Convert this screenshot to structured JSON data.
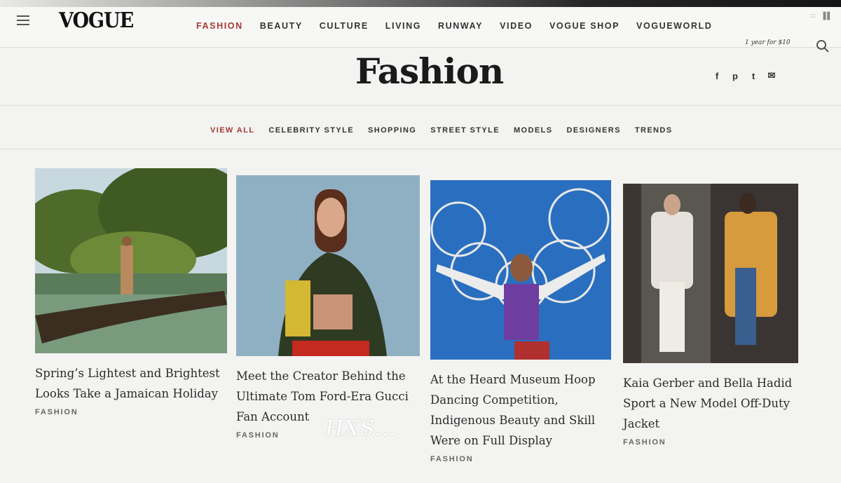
{
  "header": {
    "logo": "VOGUE",
    "nav": [
      "FASHION",
      "BEAUTY",
      "CULTURE",
      "LIVING",
      "RUNWAY",
      "VIDEO",
      "VOGUE SHOP",
      "VOGUEWORLD"
    ],
    "active_nav": "FASHION",
    "subscribe": "1 year for $10",
    "status_icons": "∷ ▐▌"
  },
  "page": {
    "title": "Fashion",
    "social": [
      "f",
      "p",
      "t",
      "✉"
    ]
  },
  "subnav": [
    "VIEW ALL",
    "CELEBRITY STYLE",
    "SHOPPING",
    "STREET STYLE",
    "MODELS",
    "DESIGNERS",
    "TRENDS"
  ],
  "articles": [
    {
      "title": "Spring’s Lightest and Brightest Looks Take a Jamaican Holiday",
      "tag": "FASHION"
    },
    {
      "title": "Meet the Creator Behind the Ultimate Tom Ford-Era Gucci Fan Account",
      "tag": "FASHION"
    },
    {
      "title": "At the Heard Museum Hoop Dancing Competition, Indigenous Beauty and Skill Were on Full Display",
      "tag": "FASHION"
    },
    {
      "title": "Kaia Gerber and Bella Hadid Sport a New Model Off-Duty Jacket",
      "tag": "FASHION"
    }
  ],
  "watermark": "HXS...",
  "colors": {
    "accent": "#a23a37",
    "background": "#f3f3f1"
  }
}
